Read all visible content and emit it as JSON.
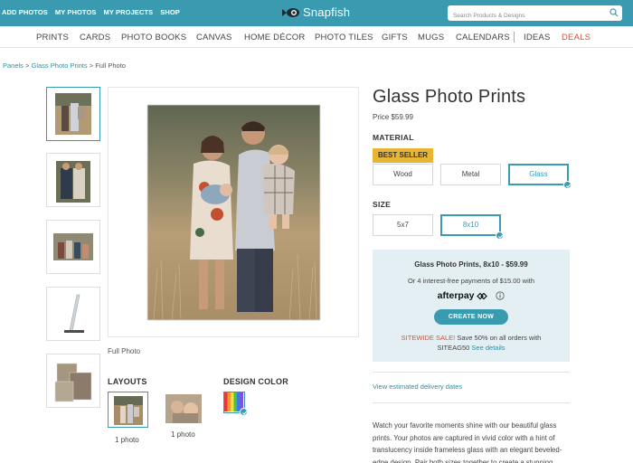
{
  "topnav": {
    "items": [
      "ADD PHOTOS",
      "MY PHOTOS",
      "MY PROJECTS",
      "SHOP"
    ],
    "logo_text": "Snapfish",
    "search_placeholder": "Search Products & Designs"
  },
  "catnav": {
    "items": [
      "PRINTS",
      "CARDS",
      "PHOTO BOOKS",
      "CANVAS",
      "HOME DÉCOR",
      "PHOTO TILES",
      "GIFTS",
      "MUGS",
      "CALENDARS",
      "IDEAS",
      "DEALS"
    ]
  },
  "breadcrumb": {
    "link1": "Panels",
    "sep": ">",
    "link2": "Glass Photo Prints",
    "current": "Full Photo"
  },
  "gallery": {
    "caption": "Full Photo"
  },
  "layouts": {
    "label": "LAYOUTS",
    "options": [
      {
        "caption": "1 photo"
      },
      {
        "caption": "1 photo"
      }
    ]
  },
  "design_color": {
    "label": "DESIGN COLOR"
  },
  "product": {
    "title": "Glass Photo Prints",
    "price": "Price $59.99",
    "material_label": "MATERIAL",
    "badge": "BEST SELLER",
    "materials": [
      "Wood",
      "Metal",
      "Glass"
    ],
    "selected_material": "Glass",
    "size_label": "SIZE",
    "sizes": [
      "5x7",
      "8x10"
    ],
    "selected_size": "8x10"
  },
  "promo": {
    "title": "Glass Photo Prints, 8x10 - $59.99",
    "payments": "Or 4 interest-free payments of $15.00 with",
    "afterpay": "afterpay",
    "cta": "CREATE NOW",
    "sale_label": "SITEWIDE SALE!",
    "sale_text": "Save 50% on all orders with",
    "code": "SITEAG50",
    "see_details": "See details"
  },
  "delivery_link": "View estimated delivery dates",
  "description": "Watch your favorite moments shine with our beautiful glass prints. Your photos are captured in vivid color with a hint of translucency inside frameless glass with an elegant beveled-edge design. Pair both sizes together to create a stunning",
  "colors": {
    "accent": "#3a9bb0",
    "link": "#2f8ea3",
    "badge": "#e8b535",
    "deals": "#d2553a",
    "promo_bg": "#e3eff3"
  }
}
